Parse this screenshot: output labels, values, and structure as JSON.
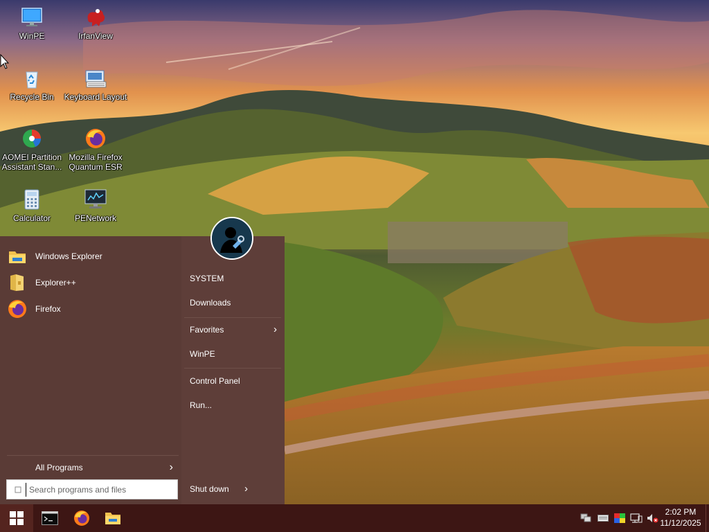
{
  "desktop": {
    "icons": [
      {
        "label": "WinPE",
        "icon": "monitor-icon"
      },
      {
        "label": "IrfanView",
        "icon": "irfanview-icon"
      },
      {
        "label": "Recycle Bin",
        "icon": "recycle-bin-icon"
      },
      {
        "label": "Keyboard Layout",
        "icon": "keyboard-icon"
      },
      {
        "label": "AOMEI Partition Assistant Stan...",
        "icon": "aomei-icon"
      },
      {
        "label": "Mozilla Firefox Quantum ESR",
        "icon": "firefox-icon"
      },
      {
        "label": "Calculator",
        "icon": "calculator-icon"
      },
      {
        "label": "PENetwork",
        "icon": "network-monitor-icon"
      }
    ]
  },
  "start_menu": {
    "programs": [
      {
        "label": "Windows Explorer",
        "icon": "folder-icon"
      },
      {
        "label": "Explorer++",
        "icon": "explorerpp-icon"
      },
      {
        "label": "Firefox",
        "icon": "firefox-icon"
      }
    ],
    "all_programs": "All Programs",
    "search_placeholder": "Search programs and files",
    "right_items": [
      {
        "label": "SYSTEM"
      },
      {
        "label": "Downloads"
      },
      {
        "label": "Favorites",
        "has_submenu": true
      },
      {
        "label": "WinPE"
      },
      {
        "label": "Control Panel"
      },
      {
        "label": "Run..."
      }
    ],
    "shutdown": "Shut down",
    "user_icon": "user-avatar-icon"
  },
  "taskbar": {
    "pinned": [
      {
        "name": "command-prompt",
        "icon": "terminal-icon"
      },
      {
        "name": "firefox",
        "icon": "firefox-icon"
      },
      {
        "name": "file-explorer",
        "icon": "folder-icon"
      }
    ],
    "tray_icons": [
      "network-icon",
      "keyboard-icon",
      "color-icon",
      "display-icon",
      "volume-muted-icon"
    ],
    "time": "2:02 PM",
    "date": "11/12/2025"
  },
  "colors": {
    "start_menu_bg": "#5a3b36",
    "taskbar_bg": "#3d1614",
    "start_button_bg": "#54241f"
  }
}
